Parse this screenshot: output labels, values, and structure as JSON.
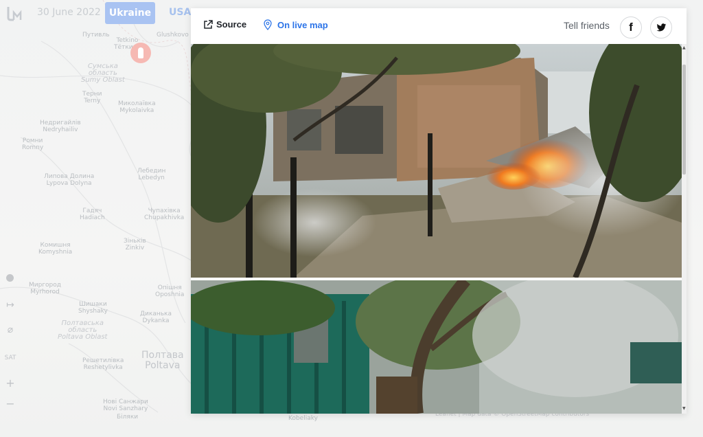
{
  "topbar": {
    "date": "30 June 2022",
    "tab_ukraine": "Ukraine",
    "tab_usa": "USA"
  },
  "map": {
    "places": [
      {
        "id": "putyvl",
        "text": "Путивль"
      },
      {
        "id": "glushkovo",
        "text": "Glushkovo"
      },
      {
        "id": "tetkino",
        "text": "Tetkino\nТёткино"
      },
      {
        "id": "sumy-oblast",
        "text": "Сумська\nобласть\nSumy Oblast"
      },
      {
        "id": "terny",
        "text": "Терни\nTerny"
      },
      {
        "id": "mykolaivka",
        "text": "Миколаївка\nMykolaivka"
      },
      {
        "id": "nedryhailiv",
        "text": "Недригайлів\nNedryhailiv"
      },
      {
        "id": "romny",
        "text": "Ромни\nRomny"
      },
      {
        "id": "lypova-dolyna",
        "text": "Липова Долина\nLypova Dolyna"
      },
      {
        "id": "lebedyn",
        "text": "Лебедин\nLebedyn"
      },
      {
        "id": "hadiach",
        "text": "Гадяч\nHadiach"
      },
      {
        "id": "chupakhivka",
        "text": "Чупахівка\nChupakhivka"
      },
      {
        "id": "komyshnia",
        "text": "Комишня\nKomyshnia"
      },
      {
        "id": "zinkiv",
        "text": "Зіньків\nZinkiv"
      },
      {
        "id": "myrhorod",
        "text": "Миргород\nMyrhorod"
      },
      {
        "id": "oposhnia",
        "text": "Опішня\nOposhnia"
      },
      {
        "id": "shyshaky",
        "text": "Шишаки\nShyshaky"
      },
      {
        "id": "dykanka",
        "text": "Диканька\nDykanka"
      },
      {
        "id": "poltava-oblast",
        "text": "Полтавська\nобласть\nPoltava Oblast"
      },
      {
        "id": "poltava",
        "text": "Полтава\nPoltava"
      },
      {
        "id": "reshetylivka",
        "text": "Решетилівка\nReshetylivka"
      },
      {
        "id": "novi-sanzhary",
        "text": "Нові Санжари\nNovi Sanzhary"
      },
      {
        "id": "biliaky",
        "text": "Біляки"
      },
      {
        "id": "kobeliaky",
        "text": "Kobeliaky"
      }
    ],
    "controls": {
      "ruler": "↦",
      "eye": "⌀",
      "sat": "SAT",
      "zoom_in": "+",
      "zoom_out": "−"
    }
  },
  "popup": {
    "source_label": "Source",
    "live_map_label": "On live map",
    "tell_friends": "Tell friends",
    "facebook_glyph": "f",
    "photos": [
      {
        "subject": "burning brick house with collapsed roof and fence posts"
      },
      {
        "subject": "green wooden fence and trees in smoke"
      }
    ]
  },
  "attribution": "Leaflet | Map data © OpenStreetMap contributors"
}
